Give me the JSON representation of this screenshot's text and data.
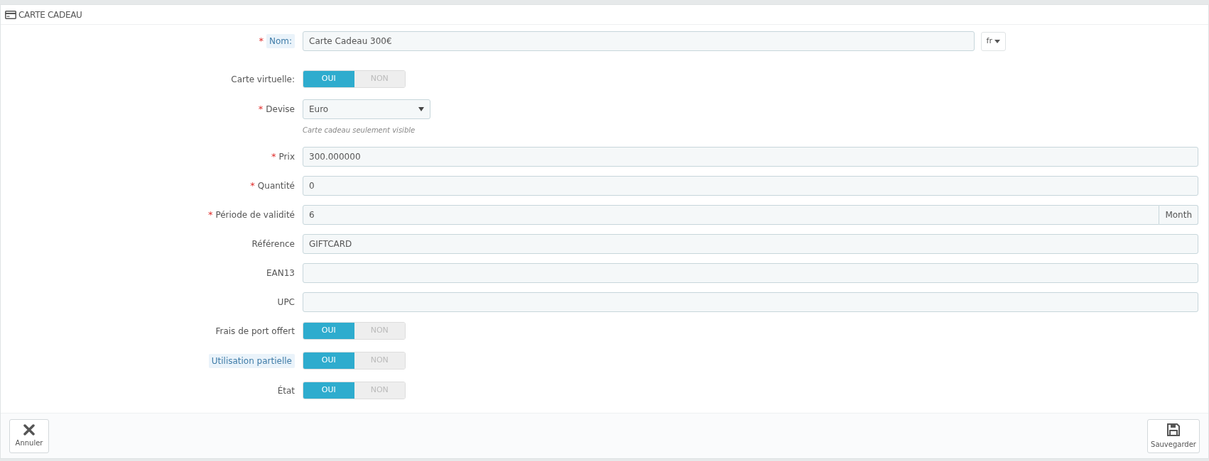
{
  "panel": {
    "title": "CARTE CADEAU"
  },
  "fields": [
    {
      "kind": "text",
      "label": "Nom:",
      "required_mark": "*",
      "tooltip": true,
      "value": "Carte Cadeau 300€",
      "language": "fr"
    },
    {
      "kind": "switch",
      "label": "Carte virtuelle:",
      "tooltip": false,
      "options": [
        {
          "label": "OUI",
          "selected": true
        },
        {
          "label": "NON",
          "selected": false
        }
      ]
    },
    {
      "kind": "select",
      "label": "Devise",
      "required_mark": "*",
      "tooltip": false,
      "value": "Euro",
      "help": "Carte cadeau seulement visible"
    },
    {
      "kind": "text",
      "label": "Prix",
      "required_mark": "*",
      "tooltip": false,
      "value": "300.000000"
    },
    {
      "kind": "text",
      "label": "Quantité",
      "required_mark": "*",
      "tooltip": false,
      "value": "0"
    },
    {
      "kind": "text",
      "label": "Période de validité",
      "required_mark": "*",
      "tooltip": false,
      "value": "6",
      "suffix": "Month"
    },
    {
      "kind": "text",
      "label": "Référence",
      "tooltip": false,
      "value": "GIFTCARD"
    },
    {
      "kind": "text",
      "label": "EAN13",
      "tooltip": false
    },
    {
      "kind": "text",
      "label": "UPC",
      "tooltip": false
    },
    {
      "kind": "switch",
      "label": "Frais de port offert",
      "tooltip": false,
      "options": [
        {
          "label": "OUI",
          "selected": true
        },
        {
          "label": "NON",
          "selected": false
        }
      ]
    },
    {
      "kind": "switch",
      "label": "Utilisation partielle",
      "tooltip": true,
      "options": [
        {
          "label": "OUI",
          "selected": true
        },
        {
          "label": "NON",
          "selected": false
        }
      ]
    },
    {
      "kind": "switch",
      "label": "État",
      "tooltip": false,
      "options": [
        {
          "label": "OUI",
          "selected": true
        },
        {
          "label": "NON",
          "selected": false
        }
      ]
    }
  ],
  "footer": {
    "cancel": "Annuler",
    "save": "Sauvegarder"
  }
}
